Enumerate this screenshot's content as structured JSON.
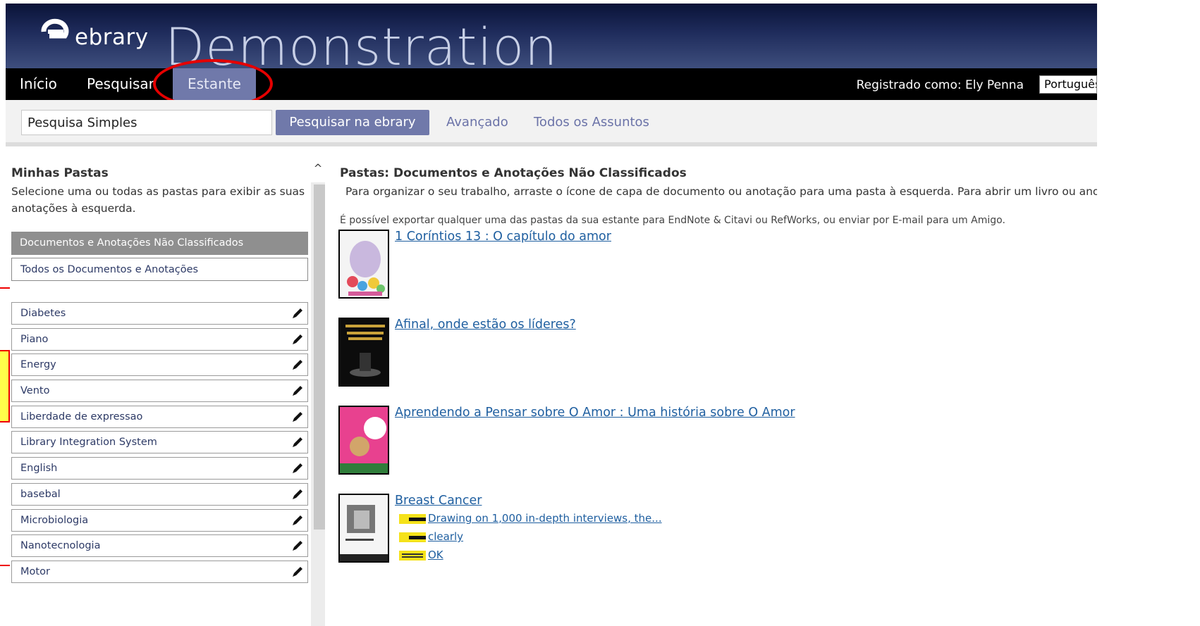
{
  "header": {
    "logo_text": "ebrary",
    "title": "Demonstration"
  },
  "nav": {
    "tabs": [
      "Início",
      "Pesquisar",
      "Estante"
    ],
    "active_tab": "Estante",
    "registered_label": "Registrado como:  Ely Penna",
    "language": "Português"
  },
  "search": {
    "value": "Pesquisa Simples",
    "button_label": "Pesquisar na ebrary",
    "advanced_label": "Avançado",
    "subjects_label": "Todos os Assuntos"
  },
  "left": {
    "title": "Minhas Pastas",
    "description": " Selecione uma ou todas as pastas para exibir as suas anotações à esquerda.",
    "unclassified_label": "Documentos e Anotações Não Classificados",
    "all_label": "Todos os Documentos e Anotações",
    "folders": [
      "Diabetes",
      "Piano",
      "Energy",
      "Vento",
      "Liberdade de expressao",
      "Library Integration System",
      "English",
      "basebal",
      "Microbiologia",
      "Nanotecnologia",
      "Motor"
    ]
  },
  "right": {
    "title": "Pastas: Documentos e Anotações Não Classificados",
    "instructions": "Para organizar o seu trabalho, arraste o ícone de capa de documento ou anotação para uma pasta à esquerda. Para abrir um livro ou anota",
    "export_note": "É possível exportar qualquer uma das pastas da sua estante para EndNote & Citavi ou RefWorks, ou enviar por E-mail para um Amigo.",
    "documents": [
      {
        "title": "1 Coríntios 13 : O capítulo do amor"
      },
      {
        "title": "Afinal, onde estão os líderes?"
      },
      {
        "title": "Aprendendo a Pensar sobre O Amor : Uma história sobre O Amor"
      },
      {
        "title": "Breast Cancer"
      }
    ],
    "annotations": [
      "Drawing on 1,000 in-depth interviews, the...",
      "clearly",
      "OK"
    ]
  },
  "colors": {
    "accent": "#7079aa",
    "annotation_red": "#e50000",
    "highlight_yellow": "#ffff4a",
    "link_blue": "#1f5fa0"
  }
}
